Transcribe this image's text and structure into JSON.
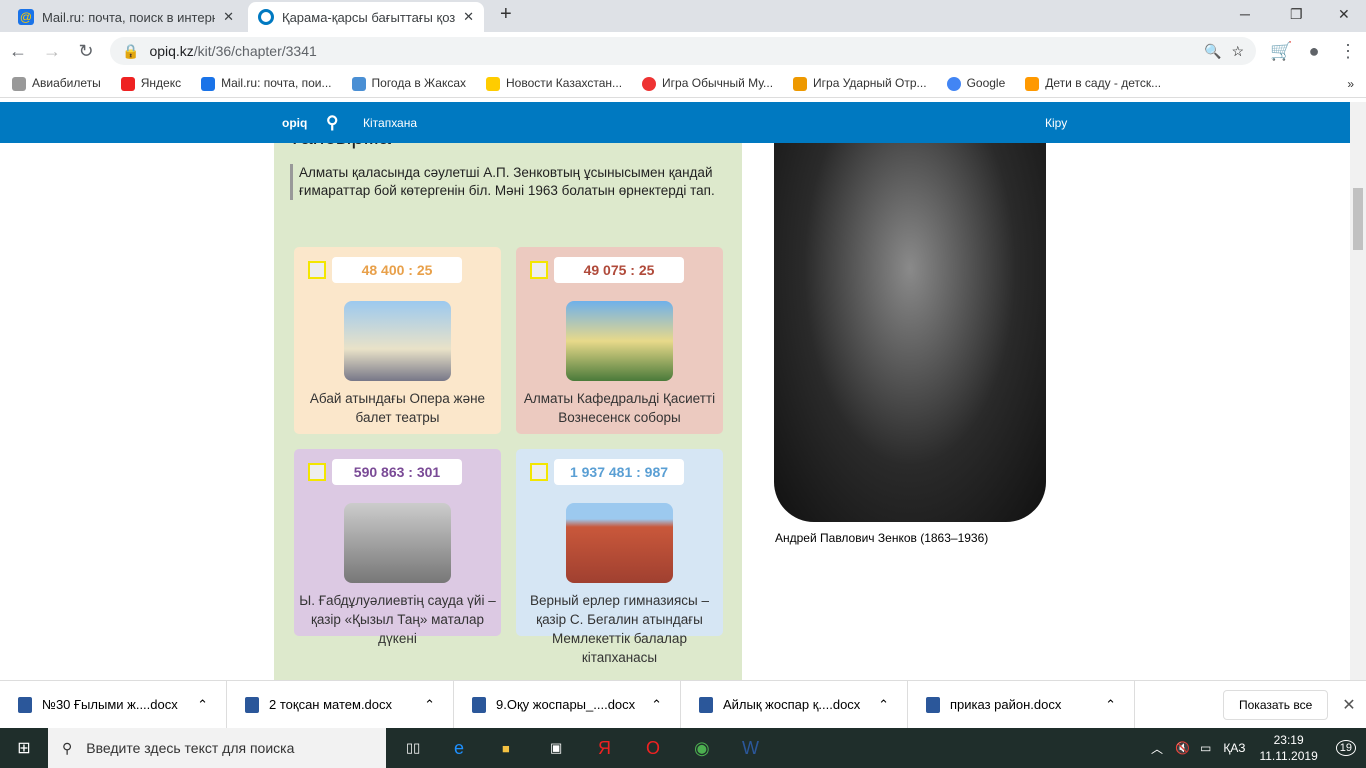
{
  "browser": {
    "tabs": [
      {
        "title": "Mail.ru: почта, поиск в интернете"
      },
      {
        "title": "Қарама-қарсы бағыттағы қозғалыс"
      }
    ],
    "url_host": "opiq.kz",
    "url_path": "/kit/36/chapter/3341",
    "bookmarks": [
      "Авиабилеты",
      "Яндекс",
      "Mail.ru: почта, пои...",
      "Погода в Жаксах",
      "Новости Казахстан...",
      "Игра Обычный Му...",
      "Игра Ударный Отр...",
      "Google",
      "Дети в саду - детск..."
    ]
  },
  "site": {
    "logo": "opiq",
    "library": "Кітапхана",
    "login": "Кіру",
    "heading_partial": "Тапсырма",
    "task_text": "Алматы қаласында сәулетші А.П. Зенковтың ұсынысымен қандай ғимараттар бой көтергенін біл. Мәні 1963 болатын өрнектерді тап.",
    "cards": [
      {
        "expr": "48 400 : 25",
        "caption": "Абай атындағы Опера және балет театры",
        "bg": "#fbe7cb",
        "color": "#e8a04a"
      },
      {
        "expr": "49 075 : 25",
        "caption": "Алматы Кафедральді Қасиетті Вознесенск соборы",
        "bg": "#eccac0",
        "color": "#b04a3a"
      },
      {
        "expr": "590 863 : 301",
        "caption": "Ы. Ғабдұлуәлиевтің сауда үйі – қазір «Қызыл Таң» маталар дүкені",
        "bg": "#dcc9e3",
        "color": "#7a4a96"
      },
      {
        "expr": "1 937 481 : 987",
        "caption": "Верный ерлер гимназиясы – қазір С. Бегалин атындағы Мемлекеттік балалар кітапханасы",
        "bg": "#d6e6f4",
        "color": "#5a9fd4"
      }
    ],
    "portrait_caption": "Андрей Павлович Зенков (1863–1936)"
  },
  "downloads": {
    "items": [
      "№30 Ғылыми ж....docx",
      "2 тоқсан матем.docx",
      "9.Оқу жоспары_....docx",
      "Айлық жоспар қ....docx",
      "приказ район.docx"
    ],
    "show_all": "Показать все"
  },
  "taskbar": {
    "search_placeholder": "Введите здесь текст для поиска",
    "lang": "ҚАЗ",
    "time": "23:19",
    "date": "11.11.2019",
    "notifications": "19"
  }
}
